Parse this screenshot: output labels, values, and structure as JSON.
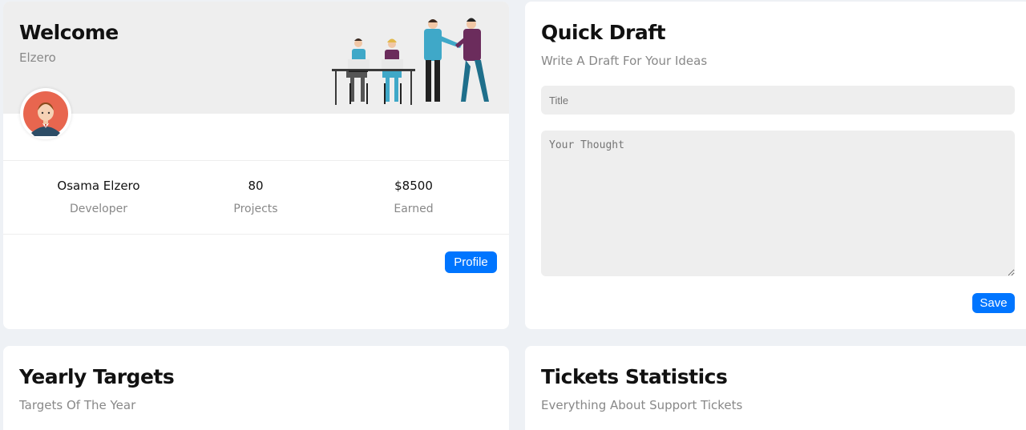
{
  "welcome": {
    "title": "Welcome",
    "subtitle": "Elzero",
    "stats": [
      {
        "value": "Osama Elzero",
        "label": "Developer"
      },
      {
        "value": "80",
        "label": "Projects"
      },
      {
        "value": "$8500",
        "label": "Earned"
      }
    ],
    "profile_button": "Profile"
  },
  "draft": {
    "title": "Quick Draft",
    "subtitle": "Write A Draft For Your Ideas",
    "title_placeholder": "Title",
    "thought_placeholder": "Your Thought",
    "save_button": "Save"
  },
  "yearly": {
    "title": "Yearly Targets",
    "subtitle": "Targets Of The Year"
  },
  "tickets": {
    "title": "Tickets Statistics",
    "subtitle": "Everything About Support Tickets"
  },
  "colors": {
    "accent": "#0075ff",
    "page_bg": "#eef1f5",
    "field_bg": "#eeeeee"
  }
}
